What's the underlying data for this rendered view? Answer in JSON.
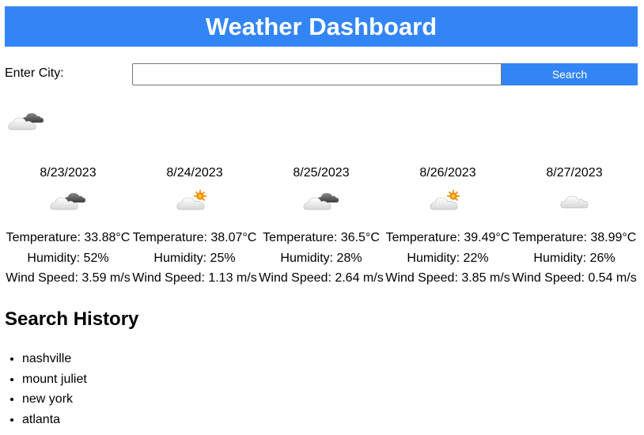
{
  "header": {
    "title": "Weather Dashboard"
  },
  "search": {
    "label": "Enter City:",
    "value": "",
    "placeholder": "",
    "button_label": "Search"
  },
  "current": {
    "icon": "broken-clouds-icon"
  },
  "forecast": [
    {
      "date": "8/23/2023",
      "icon": "broken-clouds-icon",
      "temperature": "Temperature: 33.88°C",
      "humidity": "Humidity: 52%",
      "wind": "Wind Speed: 3.59 m/s"
    },
    {
      "date": "8/24/2023",
      "icon": "few-clouds-icon",
      "temperature": "Temperature: 38.07°C",
      "humidity": "Humidity: 25%",
      "wind": "Wind Speed: 1.13 m/s"
    },
    {
      "date": "8/25/2023",
      "icon": "broken-clouds-icon",
      "temperature": "Temperature: 36.5°C",
      "humidity": "Humidity: 28%",
      "wind": "Wind Speed: 2.64 m/s"
    },
    {
      "date": "8/26/2023",
      "icon": "few-clouds-icon",
      "temperature": "Temperature: 39.49°C",
      "humidity": "Humidity: 22%",
      "wind": "Wind Speed: 3.85 m/s"
    },
    {
      "date": "8/27/2023",
      "icon": "scattered-clouds-icon",
      "temperature": "Temperature: 38.99°C",
      "humidity": "Humidity: 26%",
      "wind": "Wind Speed: 0.54 m/s"
    }
  ],
  "history": {
    "title": "Search History",
    "items": [
      "nashville",
      "mount juliet",
      "new york",
      "atlanta"
    ]
  },
  "colors": {
    "accent": "#3385f5",
    "sun": "#f5a300",
    "cloud_light": "#f2f2f2",
    "cloud_dark": "#6b6b6b"
  }
}
